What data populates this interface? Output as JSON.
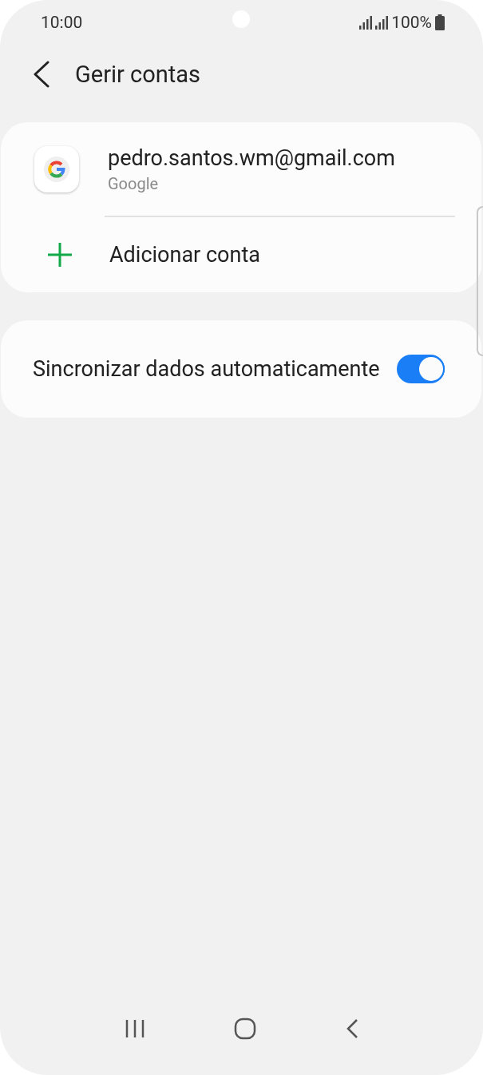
{
  "status_bar": {
    "time": "10:00",
    "battery": "100%"
  },
  "header": {
    "title": "Gerir contas"
  },
  "accounts": [
    {
      "email": "pedro.santos.wm@gmail.com",
      "provider": "Google"
    }
  ],
  "add_account": {
    "label": "Adicionar conta"
  },
  "sync": {
    "label": "Sincronizar dados automaticamente",
    "on": true
  }
}
